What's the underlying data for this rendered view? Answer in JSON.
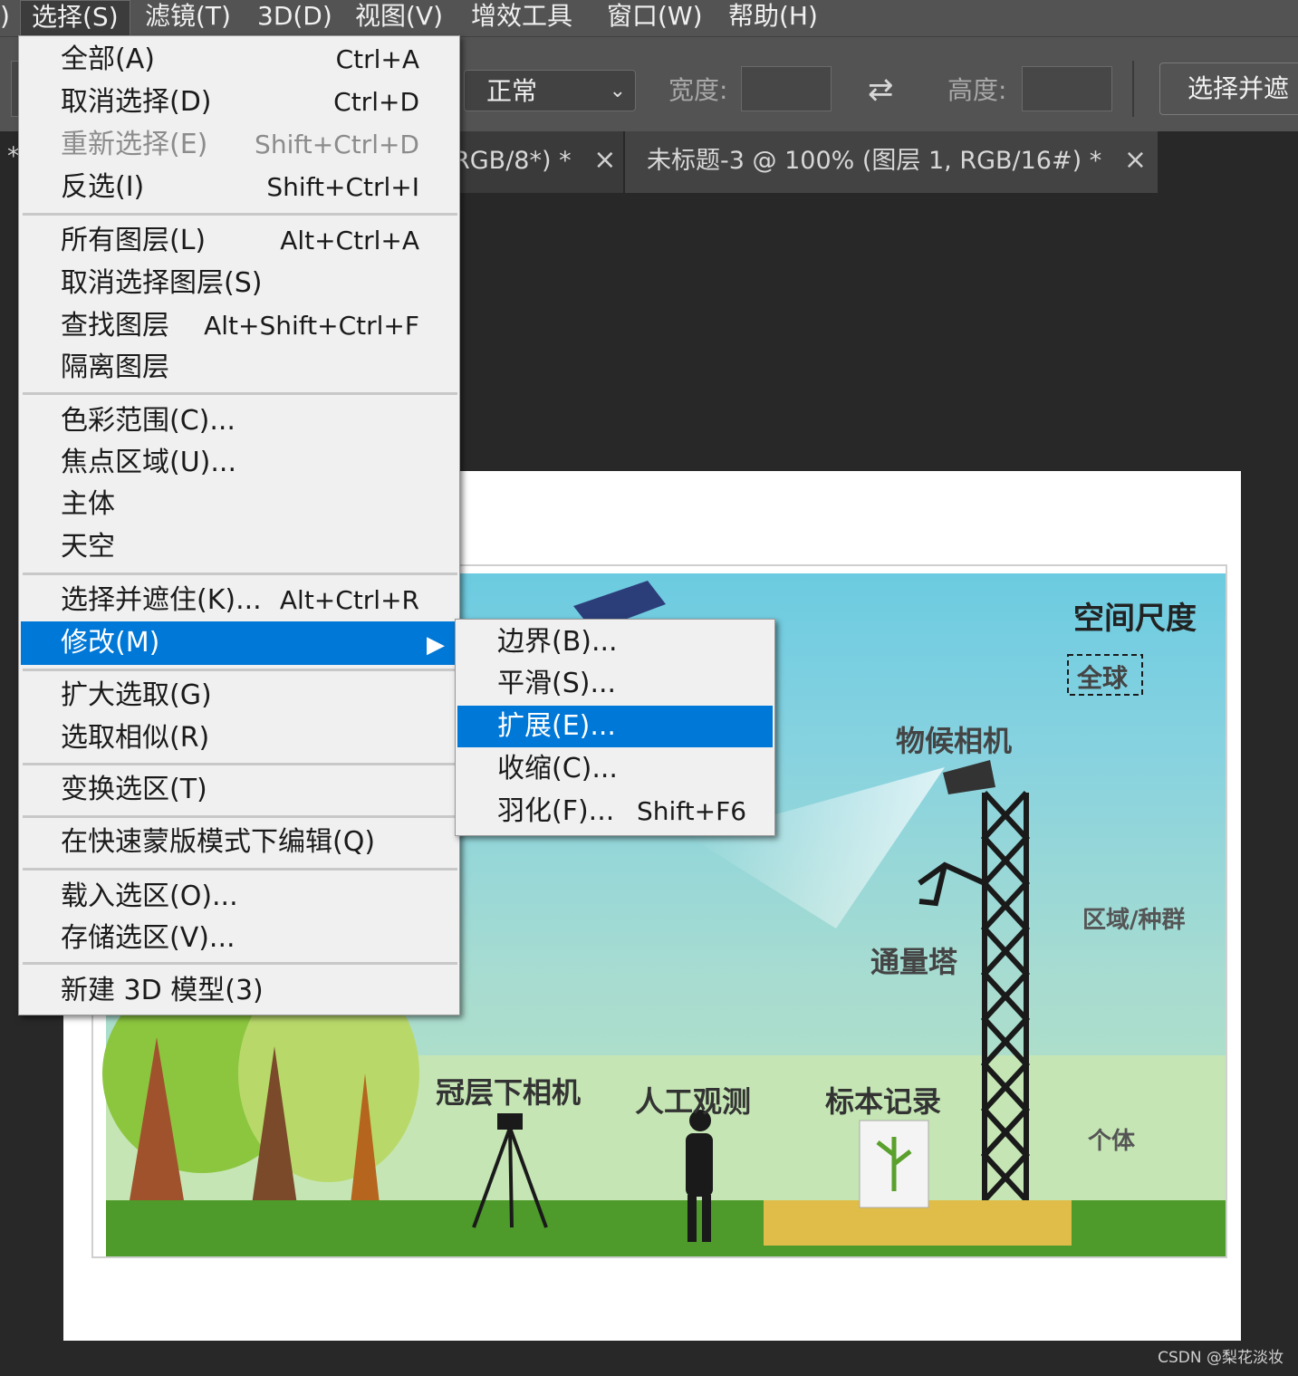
{
  "menubar": {
    "items": [
      "选择(S)",
      "滤镜(T)",
      "3D(D)",
      "视图(V)",
      "增效工具",
      "窗口(W)",
      "帮助(H)"
    ],
    "left_fragment": ")"
  },
  "options": {
    "mode_value": "正常",
    "width_label": "宽度:",
    "height_label": "高度:",
    "select_mask_button": "选择并遮"
  },
  "tabs": [
    {
      "label": "RGB/8*) *",
      "close": "×"
    },
    {
      "label": "未标题-3 @ 100% (图层 1, RGB/16#) *",
      "close": "×"
    }
  ],
  "tabs_left_fragment": "*",
  "select_menu": {
    "items": [
      {
        "label": "全部(A)",
        "shortcut": "Ctrl+A"
      },
      {
        "label": "取消选择(D)",
        "shortcut": "Ctrl+D"
      },
      {
        "label": "重新选择(E)",
        "shortcut": "Shift+Ctrl+D"
      },
      {
        "label": "反选(I)",
        "shortcut": "Shift+Ctrl+I"
      },
      {
        "label": "所有图层(L)",
        "shortcut": "Alt+Ctrl+A"
      },
      {
        "label": "取消选择图层(S)",
        "shortcut": ""
      },
      {
        "label": "查找图层",
        "shortcut": "Alt+Shift+Ctrl+F"
      },
      {
        "label": "隔离图层",
        "shortcut": ""
      },
      {
        "label": "色彩范围(C)...",
        "shortcut": ""
      },
      {
        "label": "焦点区域(U)...",
        "shortcut": ""
      },
      {
        "label": "主体",
        "shortcut": ""
      },
      {
        "label": "天空",
        "shortcut": ""
      },
      {
        "label": "选择并遮住(K)...",
        "shortcut": "Alt+Ctrl+R"
      },
      {
        "label": "修改(M)",
        "shortcut": ""
      },
      {
        "label": "扩大选取(G)",
        "shortcut": ""
      },
      {
        "label": "选取相似(R)",
        "shortcut": ""
      },
      {
        "label": "变换选区(T)",
        "shortcut": ""
      },
      {
        "label": "在快速蒙版模式下编辑(Q)",
        "shortcut": ""
      },
      {
        "label": "载入选区(O)...",
        "shortcut": ""
      },
      {
        "label": "存储选区(V)...",
        "shortcut": ""
      },
      {
        "label": "新建 3D 模型(3)",
        "shortcut": ""
      }
    ]
  },
  "modify_submenu": {
    "items": [
      {
        "label": "边界(B)...",
        "shortcut": ""
      },
      {
        "label": "平滑(S)...",
        "shortcut": ""
      },
      {
        "label": "扩展(E)...",
        "shortcut": ""
      },
      {
        "label": "收缩(C)...",
        "shortcut": ""
      },
      {
        "label": "羽化(F)...",
        "shortcut": "Shift+F6"
      }
    ]
  },
  "artwork": {
    "labels": {
      "spatial_scale": "空间尺度",
      "global": "全球",
      "phenology_camera": "物候相机",
      "region_population": "区域/种群",
      "flux_tower": "通量塔",
      "understory_camera": "冠层下相机",
      "manual_observation": "人工观测",
      "specimen_record": "标本记录",
      "individual": "个体"
    }
  },
  "watermark": "CSDN @梨花淡妆",
  "colors": {
    "menubar_bg": "#535353",
    "menu_bg": "#f0f0f0",
    "highlight": "#0078d7",
    "workspace": "#282828"
  }
}
